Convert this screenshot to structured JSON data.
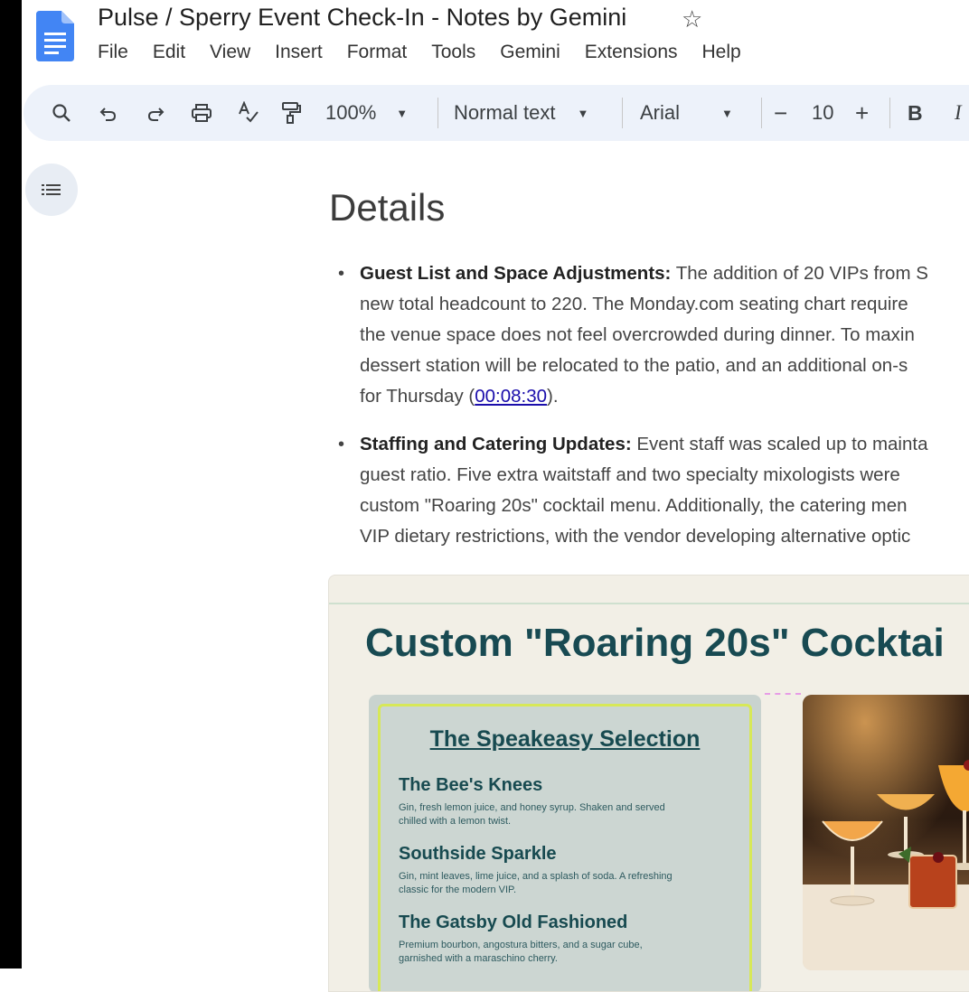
{
  "app": {
    "title": "Pulse / Sperry Event Check-In - Notes by Gemini",
    "menu": [
      "File",
      "Edit",
      "View",
      "Insert",
      "Format",
      "Tools",
      "Gemini",
      "Extensions",
      "Help"
    ]
  },
  "toolbar": {
    "zoom": "100%",
    "style": "Normal text",
    "font": "Arial",
    "font_size": "10",
    "bold": "B",
    "italic": "I"
  },
  "doc": {
    "heading": "Details",
    "bullets": [
      {
        "label": "Guest List and Space Adjustments:",
        "line1": " The addition of 20 VIPs from S",
        "line2": "new total headcount to 220. The Monday.com seating chart require",
        "line3": "the venue space does not feel overcrowded during dinner. To maxin",
        "line4": "dessert station will be relocated to the patio, and an additional on-s",
        "line5_pre": "for Thursday (",
        "timestamp": "00:08:30",
        "line5_post": ")."
      },
      {
        "label": "Staffing and Catering Updates:",
        "line1": " Event staff was scaled up to mainta",
        "line2": "guest ratio. Five extra waitstaff and two specialty mixologists were",
        "line3": "custom \"Roaring 20s\" cocktail menu. Additionally, the catering men",
        "line4": "VIP dietary restrictions, with the vendor developing alternative optic"
      }
    ],
    "embed": {
      "title": "Custom \"Roaring 20s\" Cocktai",
      "menu_heading": "The Speakeasy Selection",
      "drinks": [
        {
          "name": "The Bee's Knees",
          "desc1": "Gin, fresh lemon juice, and honey syrup. Shaken and served",
          "desc2": "chilled with a lemon twist."
        },
        {
          "name": "Southside Sparkle",
          "desc1": "Gin, mint leaves, lime juice, and a splash of soda. A refreshing",
          "desc2": "classic for the modern VIP."
        },
        {
          "name": "The Gatsby Old Fashioned",
          "desc1": "Premium bourbon, angostura bitters, and a sugar cube,",
          "desc2": "garnished with a maraschino cherry."
        }
      ]
    }
  },
  "colors": {
    "toolbar_bg": "#edf2fa",
    "embed_title": "#184a52",
    "link": "#1a0dab"
  }
}
